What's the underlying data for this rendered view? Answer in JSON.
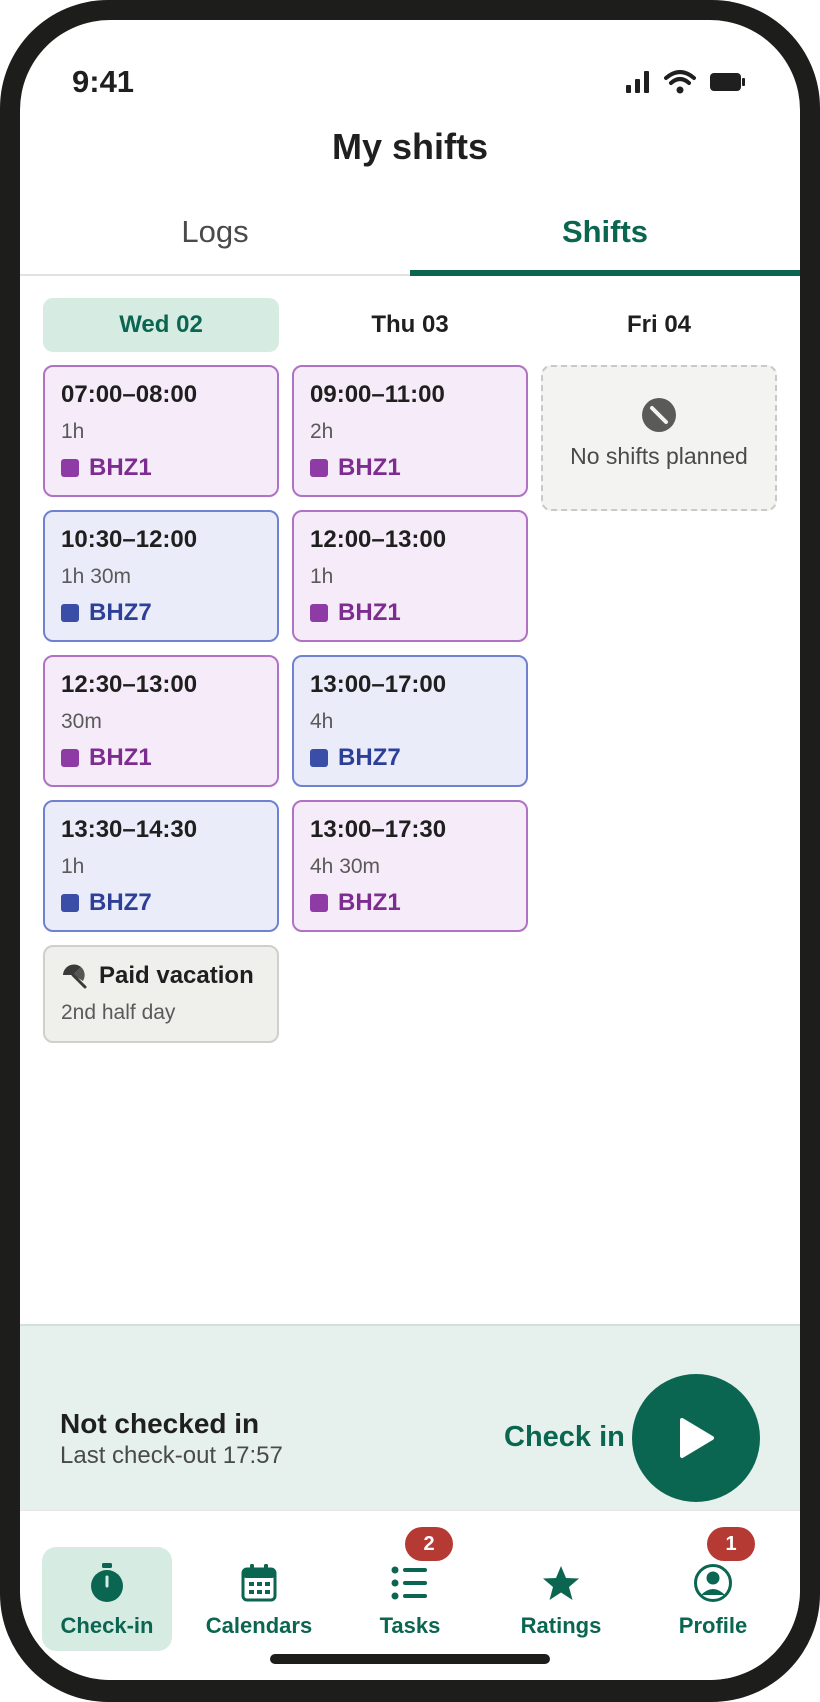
{
  "status_bar": {
    "time": "9:41"
  },
  "header": {
    "title": "My shifts"
  },
  "tabs": [
    {
      "label": "Logs",
      "active": false
    },
    {
      "label": "Shifts",
      "active": true
    }
  ],
  "days": [
    {
      "label": "Wed 02",
      "active": true,
      "shifts": [
        {
          "time": "07:00–08:00",
          "duration": "1h",
          "location": "BHZ1",
          "color": "purple"
        },
        {
          "time": "10:30–12:00",
          "duration": "1h 30m",
          "location": "BHZ7",
          "color": "blue"
        },
        {
          "time": "12:30–13:00",
          "duration": "30m",
          "location": "BHZ1",
          "color": "purple"
        },
        {
          "time": "13:30–14:30",
          "duration": "1h",
          "location": "BHZ7",
          "color": "blue"
        }
      ],
      "absence": {
        "title": "Paid vacation",
        "subtitle": "2nd half day",
        "icon": "beach-umbrella-icon"
      }
    },
    {
      "label": "Thu 03",
      "active": false,
      "shifts": [
        {
          "time": "09:00–11:00",
          "duration": "2h",
          "location": "BHZ1",
          "color": "purple"
        },
        {
          "time": "12:00–13:00",
          "duration": "1h",
          "location": "BHZ1",
          "color": "purple"
        },
        {
          "time": "13:00–17:00",
          "duration": "4h",
          "location": "BHZ7",
          "color": "blue"
        },
        {
          "time": "13:00–17:30",
          "duration": "4h 30m",
          "location": "BHZ1",
          "color": "purple"
        }
      ]
    },
    {
      "label": "Fri 04",
      "active": false,
      "empty_text": "No shifts planned",
      "empty_icon": "no-entry-icon"
    }
  ],
  "checkin": {
    "status": "Not checked in",
    "last": "Last check-out 17:57",
    "action_label": "Check in"
  },
  "nav": [
    {
      "label": "Check-in",
      "icon": "stopwatch-icon",
      "active": true
    },
    {
      "label": "Calendars",
      "icon": "calendar-icon",
      "active": false
    },
    {
      "label": "Tasks",
      "icon": "task-list-icon",
      "active": false,
      "badge": "2"
    },
    {
      "label": "Ratings",
      "icon": "star-icon",
      "active": false
    },
    {
      "label": "Profile",
      "icon": "profile-icon",
      "active": false,
      "badge": "1"
    }
  ],
  "colors": {
    "accent": "#0b6651",
    "accent_light": "#d6ece3",
    "bhz1_purple": "#8e3ba6",
    "bhz7_blue": "#3a4ea8",
    "badge_red": "#b53a33"
  }
}
